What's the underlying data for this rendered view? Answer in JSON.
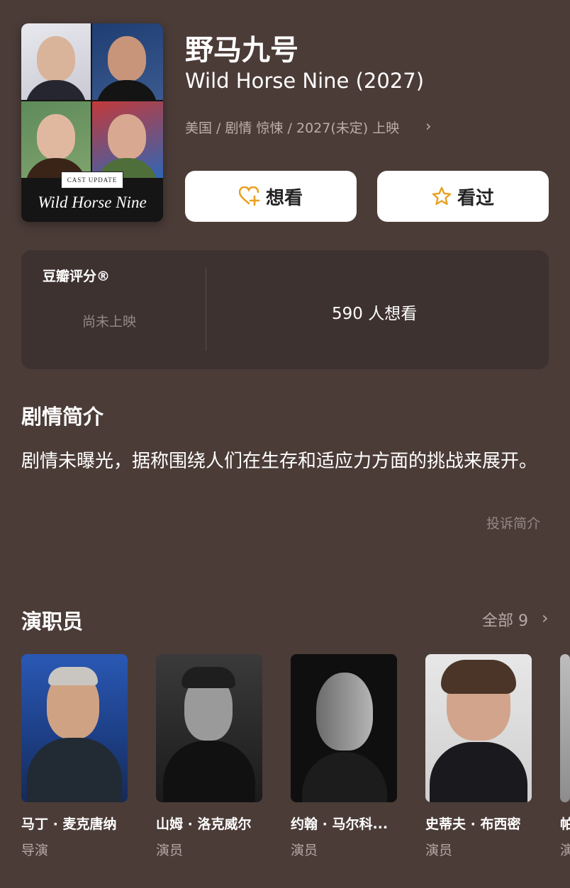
{
  "movie": {
    "title_cn": "野马九号",
    "title_en": "Wild Horse Nine (2027)",
    "meta": "美国 / 剧情 惊悚 / 2027(未定) 上映"
  },
  "poster": {
    "badge": "CAST UPDATE",
    "title": "Wild Horse Nine"
  },
  "actions": {
    "want_label": "想看",
    "seen_label": "看过",
    "icon_color": "#e8a020"
  },
  "rating": {
    "title": "豆瓣评分®",
    "status": "尚未上映",
    "want_count": "590 人想看"
  },
  "synopsis": {
    "title": "剧情简介",
    "text": "剧情未曝光，据称围绕人们在生存和适应力方面的挑战来展开。",
    "report_label": "投诉简介"
  },
  "cast": {
    "title": "演职员",
    "all_label": "全部 9",
    "members": [
      {
        "name": "马丁 · 麦克唐纳",
        "role": "导演"
      },
      {
        "name": "山姆 · 洛克威尔",
        "role": "演员"
      },
      {
        "name": "约翰 · 马尔科...",
        "role": "演员"
      },
      {
        "name": "史蒂夫 · 布西密",
        "role": "演员"
      },
      {
        "name": "帕",
        "role": "演"
      }
    ]
  },
  "colors": {
    "background": "#4b3c38",
    "card": "#3e3230",
    "button": "#ffffff"
  }
}
